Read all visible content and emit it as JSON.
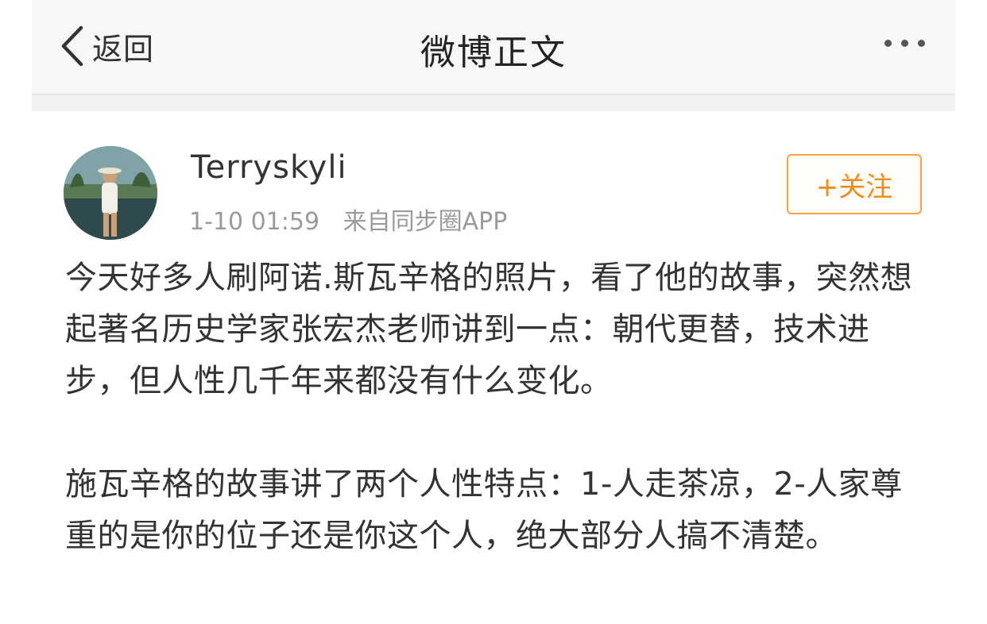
{
  "navbar": {
    "back_label": "返回",
    "title": "微博正文",
    "back_icon": "chevron-left-icon",
    "more_icon": "more-horizontal-icon"
  },
  "post": {
    "author": "Terryskyli",
    "time": "1-10 01:59",
    "source": "来自同步圈APP",
    "follow_label": "+关注",
    "paragraphs": [
      "今天好多人刷阿诺.斯瓦辛格的照片，看了他的故事，突然想起著名历史学家张宏杰老师讲到一点：朝代更替，技术进步，但人性几千年来都没有什么变化。",
      "施瓦辛格的故事讲了两个人性特点：1-人走茶凉，2-人家尊重的是你的位子还是你这个人，绝大部分人搞不清楚。"
    ]
  },
  "colors": {
    "accent": "#ef8c1c",
    "navbar_bg": "#f7f7f7",
    "text": "#333333",
    "meta": "#9a9a9a"
  }
}
